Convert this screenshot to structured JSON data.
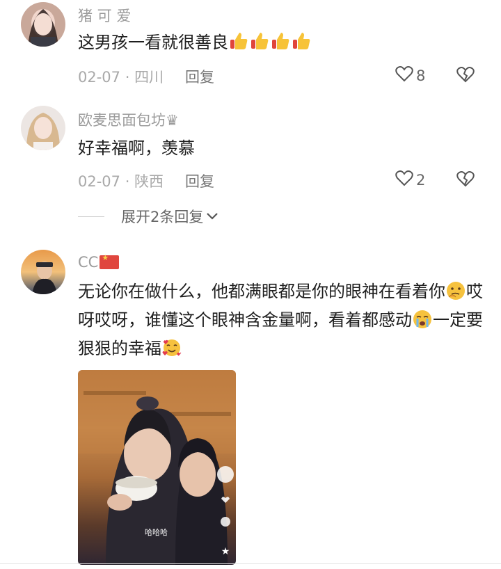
{
  "comments": [
    {
      "username": "猪 可 爱",
      "text": "这男孩一看就很善良",
      "date": "02-07",
      "sep": " · ",
      "location": "四川",
      "reply": "回复",
      "likes": "8"
    },
    {
      "username": "欧麦思面包坊♛",
      "text": "好幸福啊，羡慕",
      "date": "02-07",
      "sep": " · ",
      "location": "陕西",
      "reply": "回复",
      "likes": "2"
    },
    {
      "username": "CC",
      "text_a": "无论你在做什么，他都满眼都是你的眼神在看着你",
      "text_b": "哎呀哎呀，谁懂这个眼神含金量啊，看着都感动",
      "text_c": "一定要狠狠的幸福"
    }
  ],
  "expand_replies": "展开2条回复",
  "photo_caption": "哈哈哈",
  "colors": {
    "thumb_yellow": "#f7c338",
    "meta_gray": "#a9a9a9"
  }
}
